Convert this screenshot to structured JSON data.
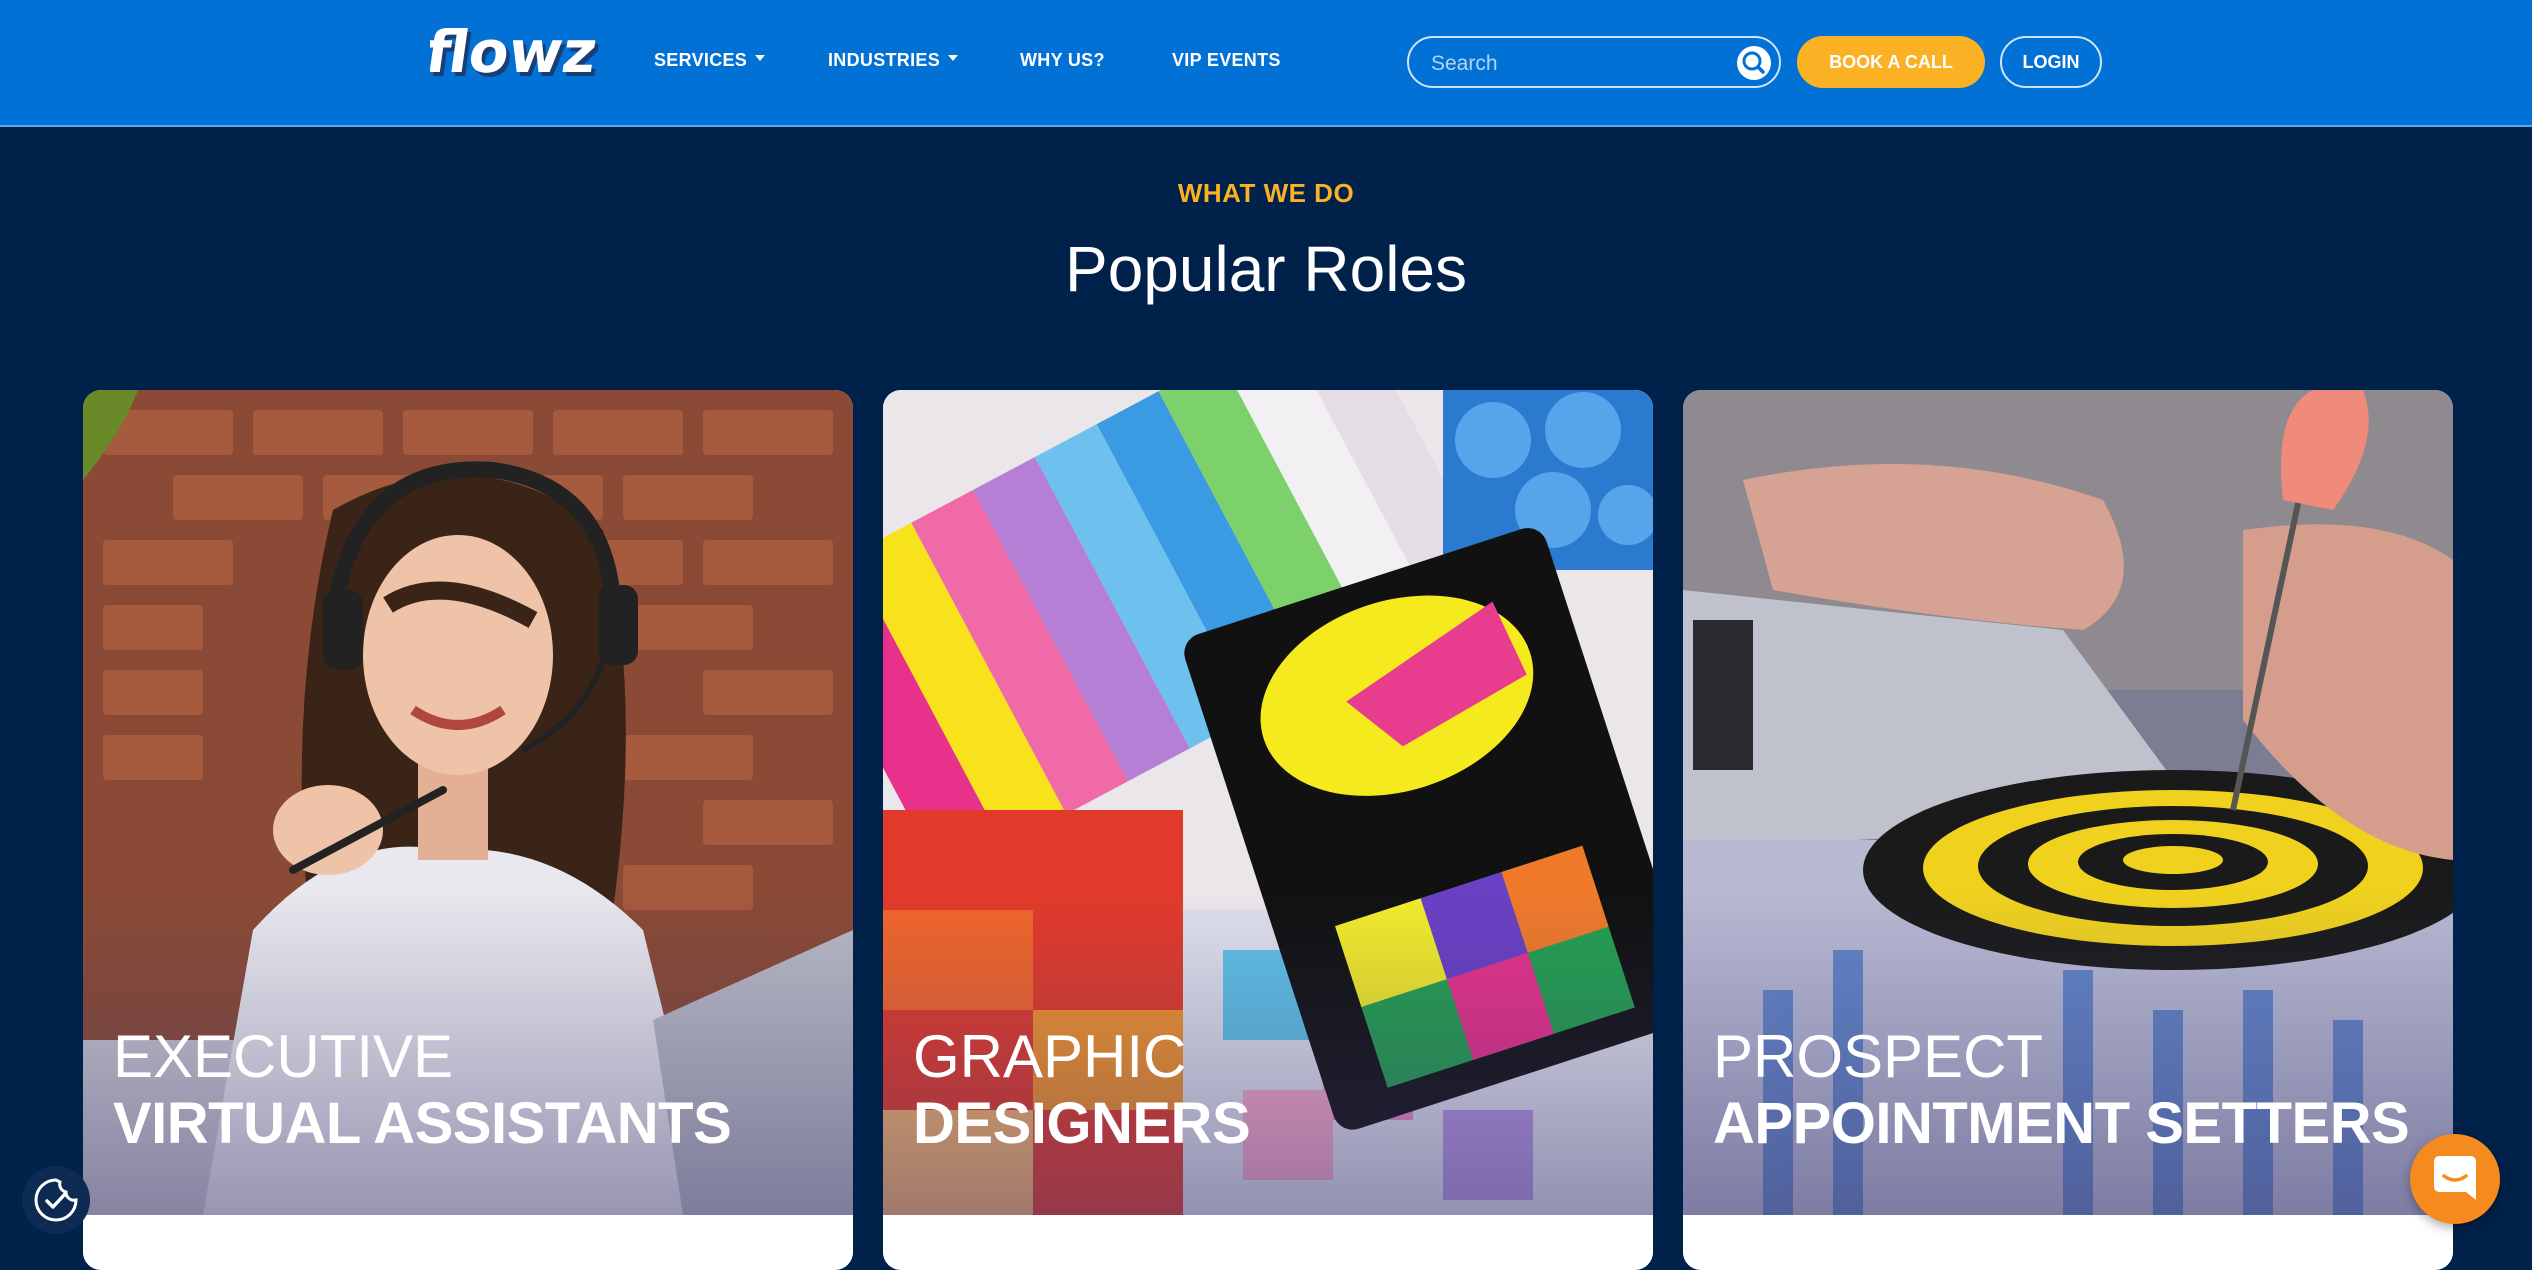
{
  "brand": {
    "logo_text": "flowz"
  },
  "nav": {
    "items": [
      {
        "label": "SERVICES",
        "has_dropdown": true
      },
      {
        "label": "INDUSTRIES",
        "has_dropdown": true
      },
      {
        "label": "WHY US?",
        "has_dropdown": false
      },
      {
        "label": "VIP EVENTS",
        "has_dropdown": false
      }
    ]
  },
  "search": {
    "placeholder": "Search",
    "value": "",
    "icon": "search-icon"
  },
  "actions": {
    "book_call": "BOOK A CALL",
    "login": "LOGIN"
  },
  "section": {
    "eyebrow": "WHAT WE DO",
    "title": "Popular Roles"
  },
  "cards": [
    {
      "line1": "EXECUTIVE",
      "line2": "VIRTUAL ASSISTANTS",
      "image": "woman-with-headset-photo"
    },
    {
      "line1": "GRAPHIC",
      "line2": "DESIGNERS",
      "image": "color-swatches-loupe-photo"
    },
    {
      "line1": "PROSPECT",
      "line2": "APPOINTMENT SETTERS",
      "image": "dart-on-target-photo"
    }
  ],
  "widgets": {
    "cookie_icon": "cookie-consent-icon",
    "chat_icon": "chat-bubble-icon"
  },
  "colors": {
    "header_bg": "#0171d5",
    "page_bg": "#00214a",
    "accent_yellow": "#fbb124",
    "chat_orange": "#f58a1f"
  }
}
